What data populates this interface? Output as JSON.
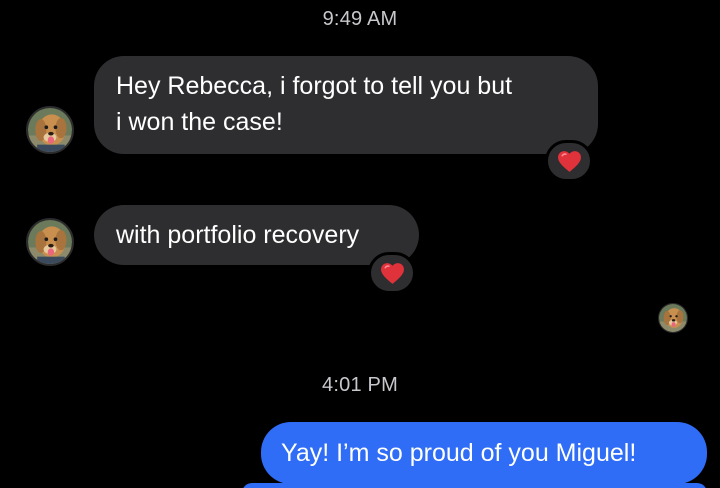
{
  "conversation": {
    "timestamps": [
      "9:49 AM",
      "4:01 PM"
    ],
    "incoming": [
      {
        "lines": [
          "Hey Rebecca, i forgot to tell you but",
          "i won the case!"
        ],
        "reaction": "heart-icon"
      },
      {
        "lines": [
          "with portfolio recovery"
        ],
        "reaction": "heart-icon"
      }
    ],
    "outgoing": [
      {
        "text": "Yay! I’m so proud of you Miguel!"
      }
    ]
  },
  "colors": {
    "background": "#000000",
    "incoming_bubble": "#2e2e30",
    "outgoing_bubble": "#2f6df6",
    "heart": "#e0323a",
    "timestamp": "#c7c7cc"
  },
  "icons": {
    "contact_avatar": "dog-avatar-icon",
    "read_receipt": "read-receipt-avatar-icon",
    "reaction": "heart-icon"
  }
}
